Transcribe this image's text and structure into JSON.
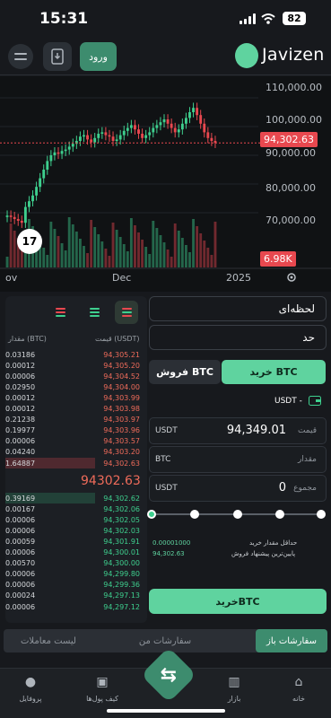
{
  "status": {
    "time": "15:31",
    "battery": "82"
  },
  "header": {
    "login_label": "ورود",
    "brand": "Javizen"
  },
  "chart_data": {
    "type": "candlestick",
    "title": "",
    "y_ticks": [
      "110,000.00",
      "100,000.00",
      "90,000.00",
      "80,000.00",
      "70,000.00"
    ],
    "x_ticks": [
      "ov",
      "Dec",
      "2025"
    ],
    "last_price_tag": "94,302.63",
    "volume_tag": "6.98K",
    "ylim": [
      55000,
      115000
    ],
    "closes": [
      69000,
      68500,
      67800,
      67200,
      66500,
      72000,
      74000,
      76000,
      79000,
      82000,
      85000,
      88000,
      90000,
      91000,
      90500,
      91500,
      92000,
      93000,
      94000,
      95000,
      96500,
      97000,
      95500,
      94500,
      96000,
      97500,
      98000,
      97000,
      96500,
      95000,
      95500,
      97000,
      98500,
      99500,
      100500,
      99000,
      97500,
      96000,
      97000,
      98000,
      99500,
      100500,
      101500,
      102500,
      101000,
      99500,
      98000,
      99000,
      101000,
      103000,
      105000,
      106500,
      104000,
      101000,
      98000,
      96000,
      95000,
      94300
    ],
    "colors": {
      "up": "#3ecf8e",
      "down": "#e8484f"
    }
  },
  "orderbook": {
    "header_price": "قیمت (USDT)",
    "header_amount": "مقدار (BTC)",
    "sells": [
      {
        "price": "94,305.21",
        "amount": "0.03186"
      },
      {
        "price": "94,305.20",
        "amount": "0.00012"
      },
      {
        "price": "94,304.52",
        "amount": "0.00006"
      },
      {
        "price": "94,304.00",
        "amount": "0.02950"
      },
      {
        "price": "94,303.99",
        "amount": "0.00012"
      },
      {
        "price": "94,303.98",
        "amount": "0.00012"
      },
      {
        "price": "94,303.97",
        "amount": "0.21238"
      },
      {
        "price": "94,303.96",
        "amount": "0.19977"
      },
      {
        "price": "94,303.57",
        "amount": "0.00006"
      },
      {
        "price": "94,303.20",
        "amount": "0.04240"
      },
      {
        "price": "94,302.63",
        "amount": "1.64887"
      }
    ],
    "mid_price": "94302.63",
    "buys": [
      {
        "price": "94,302.62",
        "amount": "0.39169"
      },
      {
        "price": "94,302.06",
        "amount": "0.00167"
      },
      {
        "price": "94,302.05",
        "amount": "0.00006"
      },
      {
        "price": "94,302.03",
        "amount": "0.00006"
      },
      {
        "price": "94,301.91",
        "amount": "0.00059"
      },
      {
        "price": "94,300.01",
        "amount": "0.00006"
      },
      {
        "price": "94,300.00",
        "amount": "0.00570"
      },
      {
        "price": "94,299.80",
        "amount": "0.00006"
      },
      {
        "price": "94,299.36",
        "amount": "0.00006"
      },
      {
        "price": "94,297.13",
        "amount": "0.00024"
      },
      {
        "price": "94,297.12",
        "amount": "0.00006"
      }
    ]
  },
  "form": {
    "order_type": "لحظه‌ای",
    "limit_type": "حد",
    "buy_tab": "خرید BTC",
    "sell_tab": "فروش BTC",
    "balance": "USDT -",
    "price_label": "قیمت",
    "price_unit": "USDT",
    "price_value": "94,349.01",
    "amount_label": "مقدار",
    "amount_unit": "BTC",
    "total_label": "مجموع",
    "total_unit": "USDT",
    "total_value": "0",
    "min_buy_label": "حداقل مقدار خرید",
    "min_buy_value": "0.00001000",
    "lowest_sell_label": "پایین‌ترین پیشنهاد فروش",
    "lowest_sell_value": "94,302.63",
    "submit_label": "خریدBTC"
  },
  "orders_tabs": [
    "سفارشات باز",
    "سفارشات من",
    "لیست معاملات"
  ],
  "nav": {
    "home": "خانه",
    "market": "بازار",
    "wallet": "کیف پول‌ها",
    "profile": "پروفایل"
  }
}
